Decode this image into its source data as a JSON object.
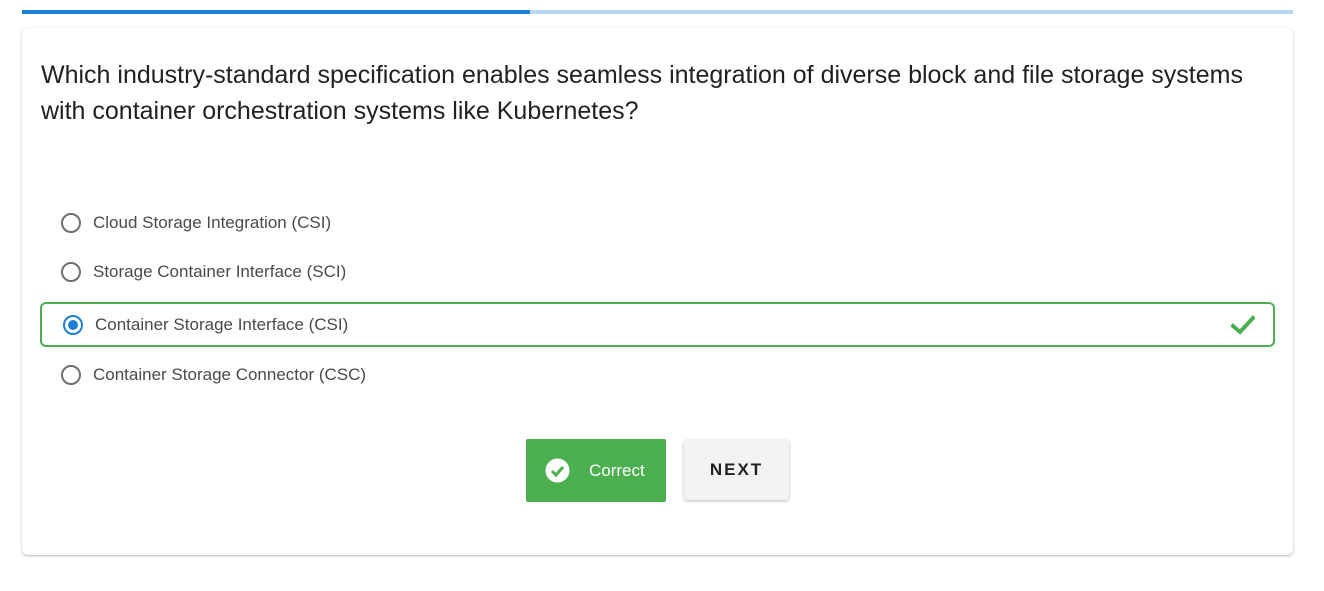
{
  "progress": {
    "fraction": 0.4
  },
  "question": {
    "text": "Which industry-standard specification enables seamless integration of diverse block and file storage systems with container orchestration systems like Kubernetes?"
  },
  "options": [
    {
      "label": "Cloud Storage Integration (CSI)",
      "selected": false
    },
    {
      "label": "Storage Container Interface (SCI)",
      "selected": false
    },
    {
      "label": "Container Storage Interface (CSI)",
      "selected": true,
      "correct": true
    },
    {
      "label": "Container Storage Connector (CSC)",
      "selected": false
    }
  ],
  "buttons": {
    "correct_label": "Correct",
    "next_label": "NEXT"
  },
  "colors": {
    "accent_blue": "#1f7fd1",
    "progress_track": "#b7d7f3",
    "success_green": "#4caf50"
  },
  "icons": {
    "option_check": "check-icon",
    "button_check": "check-circle-icon"
  }
}
